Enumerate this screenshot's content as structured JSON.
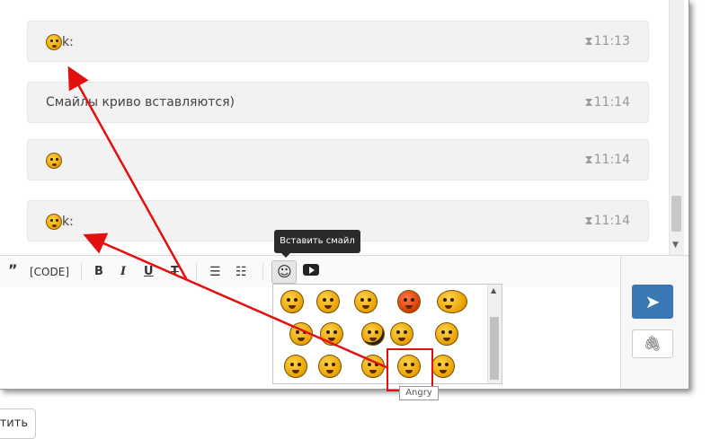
{
  "messages": [
    {
      "text": "k:",
      "time": "11:13",
      "has_smile": true
    },
    {
      "text": "Смайлы криво вставляются)",
      "time": "11:14",
      "has_smile": false
    },
    {
      "text": "",
      "time": "11:14",
      "has_smile": true
    },
    {
      "text": "k:",
      "time": "11:14",
      "has_smile": true
    }
  ],
  "toolbar": {
    "quote_label": "”",
    "code_label": "[CODE]",
    "bold_label": "B",
    "italic_label": "I",
    "underline_label": "U",
    "strike_label": "T",
    "tooltip": "Вставить смайл"
  },
  "smiley_panel": {
    "rows": 3,
    "hovered_name": "Angry"
  },
  "bottom_button_label": "тить",
  "colors": {
    "accent": "#3a77b5",
    "annotation": "#e31010",
    "message_bg": "#f2f2f2"
  },
  "icons": {
    "send": "paper-plane-icon",
    "attach": "paperclip-icon",
    "time": "hourglass-icon"
  }
}
